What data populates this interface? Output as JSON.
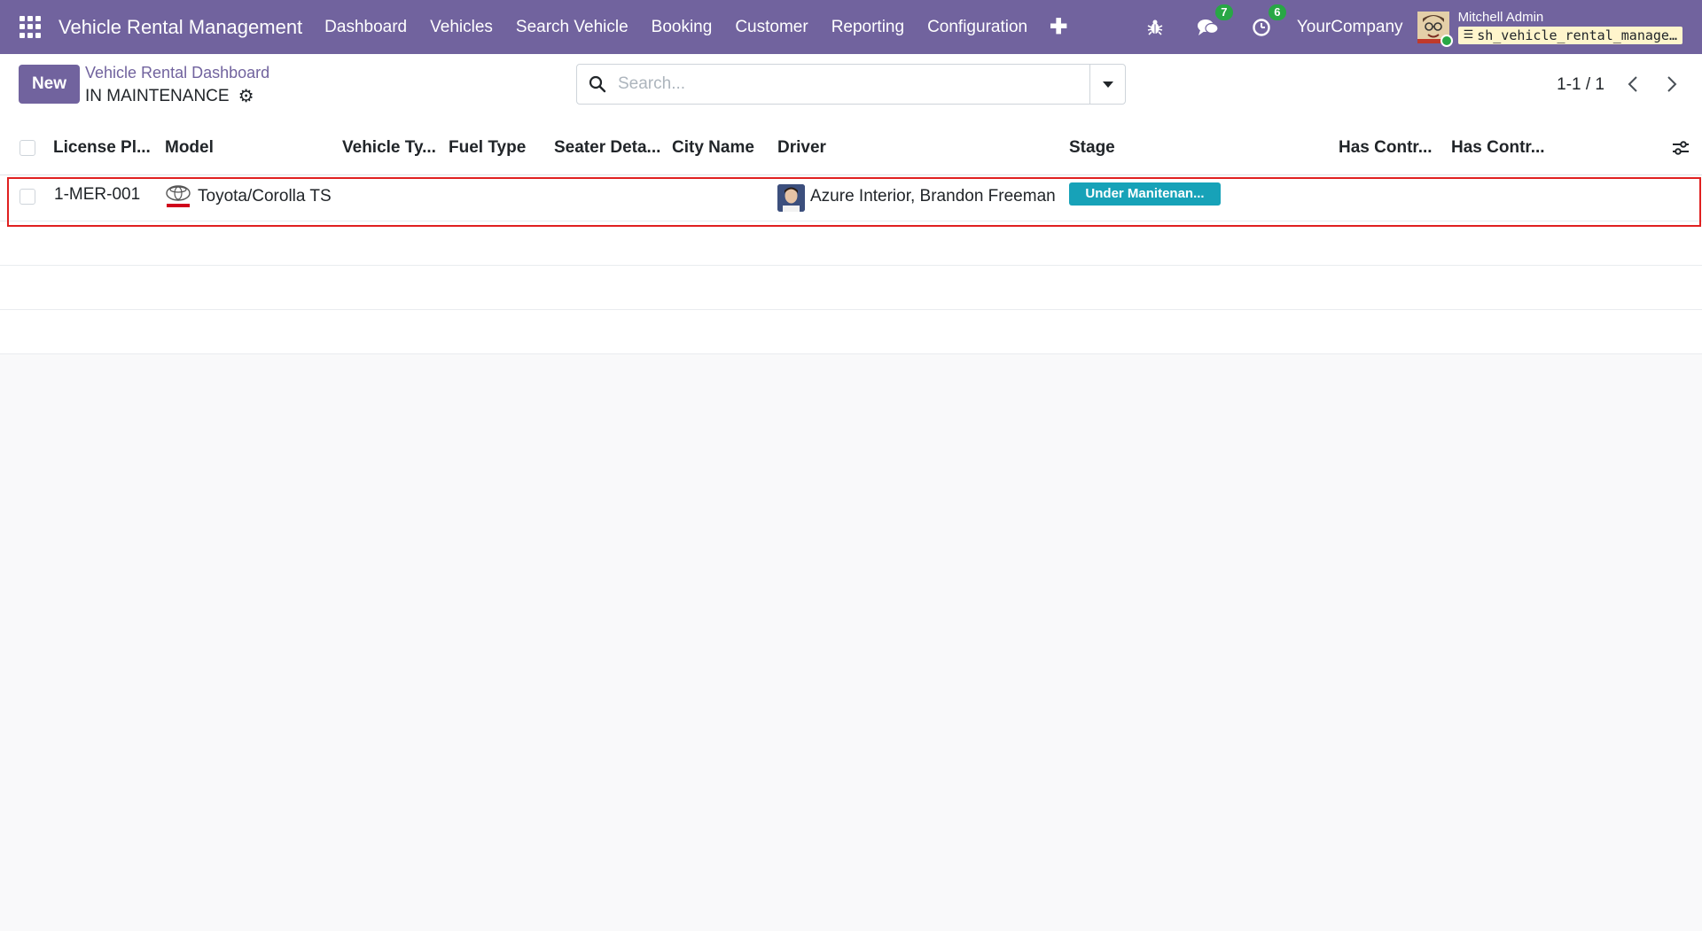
{
  "navbar": {
    "app_title": "Vehicle Rental Management",
    "menu": [
      "Dashboard",
      "Vehicles",
      "Search Vehicle",
      "Booking",
      "Customer",
      "Reporting",
      "Configuration"
    ],
    "messages_count": "7",
    "activities_count": "6",
    "company": "YourCompany",
    "user_name": "Mitchell Admin",
    "database": "sh_vehicle_rental_manage…"
  },
  "control_panel": {
    "new_label": "New",
    "breadcrumb_parent": "Vehicle Rental Dashboard",
    "breadcrumb_current": "IN MAINTENANCE",
    "search_placeholder": "Search...",
    "pager": "1-1 / 1"
  },
  "table": {
    "columns": [
      "License Pl...",
      "Model",
      "Vehicle Ty...",
      "Fuel Type",
      "Seater Deta...",
      "City Name",
      "Driver",
      "Stage",
      "Has Contr...",
      "Has Contr..."
    ],
    "rows": [
      {
        "license_plate": "1-MER-001",
        "model": "Toyota/Corolla TS",
        "vehicle_type": "",
        "fuel_type": "",
        "seater": "",
        "city": "",
        "driver": "Azure Interior, Brandon Freeman",
        "stage": "Under Manitenan...",
        "has_contract_1": "",
        "has_contract_2": ""
      }
    ]
  },
  "colors": {
    "brand": "#71639e",
    "stage_badge": "#17a2b8",
    "highlight_border": "#e02020"
  }
}
